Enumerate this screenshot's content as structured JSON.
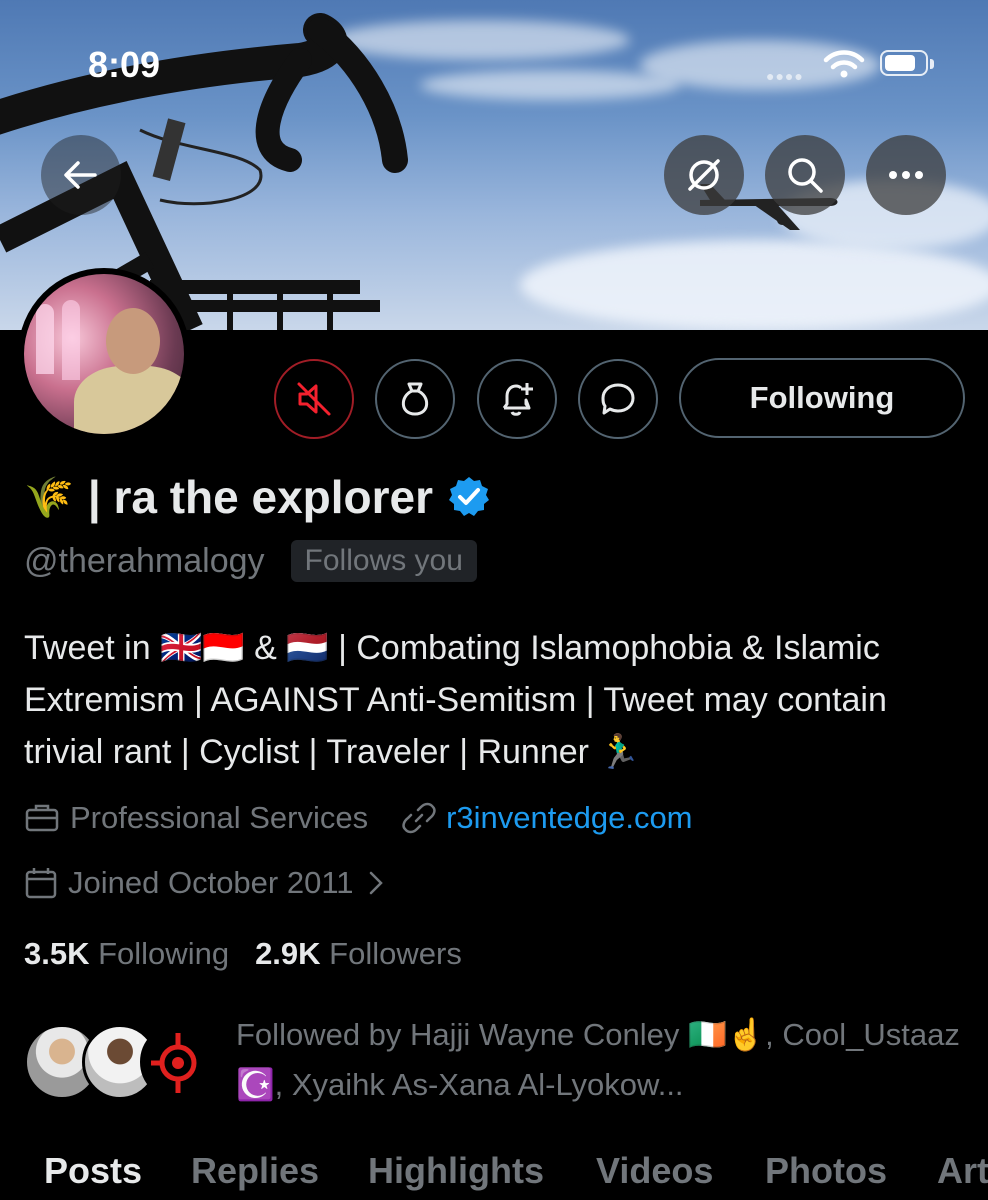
{
  "status_bar": {
    "time": "8:09"
  },
  "profile": {
    "name_emoji": "🌾",
    "display_name": "| ra the explorer",
    "handle": "@therahmalogy",
    "follows_you": "Follows you",
    "bio": "Tweet in 🇬🇧🇮🇩 & 🇳🇱 | Combating Islamophobia & Islamic Extremism | AGAINST Anti-Semitism | Tweet may contain trivial rant | Cyclist | Traveler | Runner 🏃‍♂️",
    "category": "Professional Services",
    "website": "r3inventedge.com",
    "joined": "Joined October 2011",
    "following_count": "3.5K",
    "following_label": "Following",
    "followers_count": "2.9K",
    "followers_label": "Followers",
    "followed_by": "Followed by Hajji Wayne Conley 🇮🇪☝️, Cool_Ustaaz ☪️, Xyaihk As-Xana Al-Lyokow..."
  },
  "actions": {
    "following_button": "Following"
  },
  "tabs": [
    "Posts",
    "Replies",
    "Highlights",
    "Videos",
    "Photos",
    "Art"
  ],
  "active_tab": "Posts",
  "icons": {
    "back": "arrow-left-icon",
    "hide": "eye-slash-icon",
    "search": "search-icon",
    "more": "more-icon",
    "mute": "mute-icon",
    "subscribe": "money-bag-icon",
    "notify": "bell-plus-icon",
    "message": "chat-bubble-icon",
    "verified": "verified-badge-icon",
    "category": "briefcase-icon",
    "link": "link-icon",
    "calendar": "calendar-icon"
  },
  "colors": {
    "background": "#000000",
    "text": "#e7e9ea",
    "secondary": "#71767b",
    "link": "#1d9bf0",
    "mute_red": "#f4212e",
    "verified": "#1d9bf0"
  }
}
